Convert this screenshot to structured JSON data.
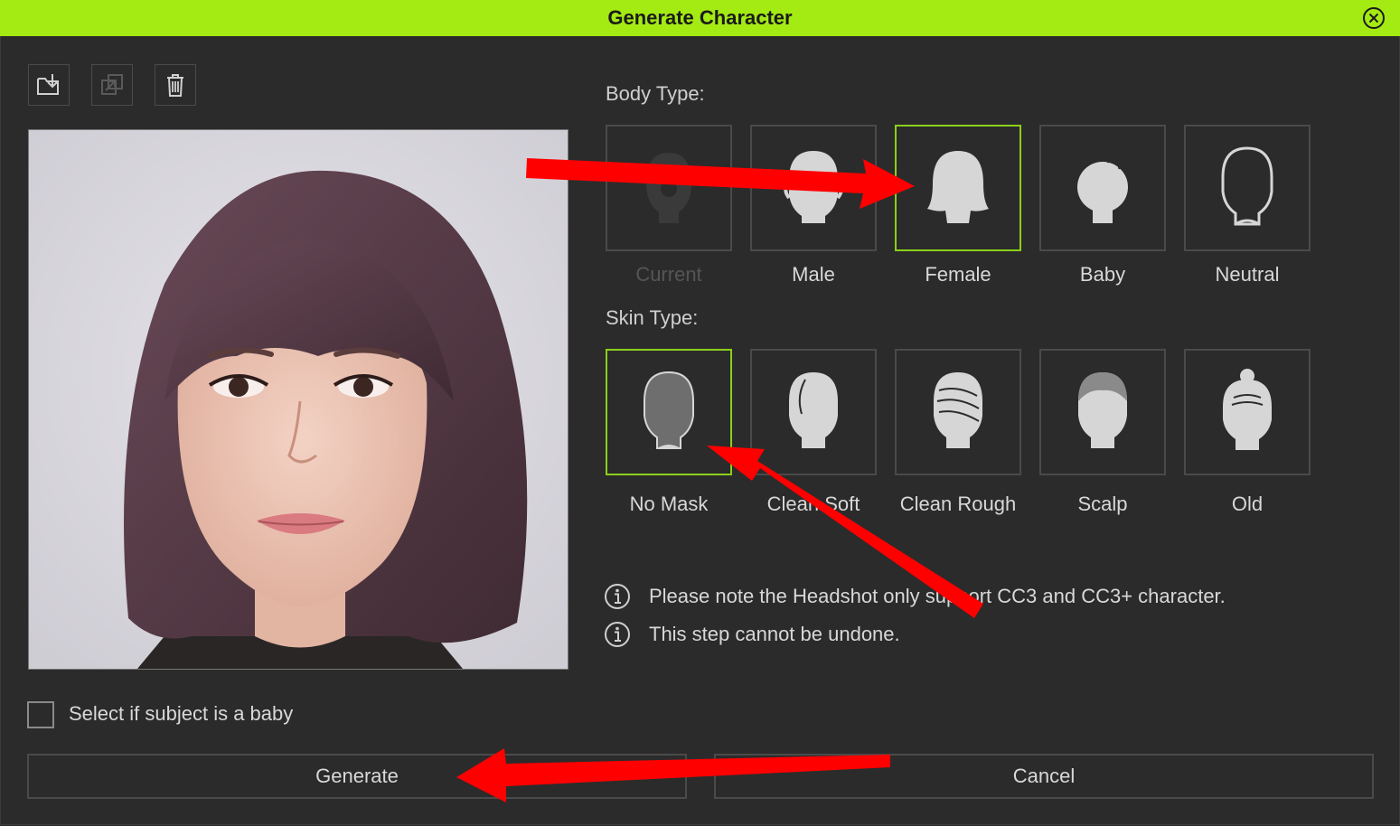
{
  "window": {
    "title": "Generate Character"
  },
  "toolbar": {
    "import_icon": "folder-import-icon",
    "replace_icon": "replace-image-icon",
    "delete_icon": "trash-icon"
  },
  "body_type": {
    "label": "Body Type:",
    "options": [
      {
        "label": "Current",
        "icon": "current-head-icon",
        "state": "disabled"
      },
      {
        "label": "Male",
        "icon": "male-head-icon",
        "state": "normal"
      },
      {
        "label": "Female",
        "icon": "female-head-icon",
        "state": "selected"
      },
      {
        "label": "Baby",
        "icon": "baby-head-icon",
        "state": "normal"
      },
      {
        "label": "Neutral",
        "icon": "neutral-head-icon",
        "state": "normal"
      }
    ]
  },
  "skin_type": {
    "label": "Skin Type:",
    "options": [
      {
        "label": "No Mask",
        "icon": "no-mask-head-icon",
        "state": "selected"
      },
      {
        "label": "Clean Soft",
        "icon": "clean-soft-head-icon",
        "state": "normal"
      },
      {
        "label": "Clean Rough",
        "icon": "clean-rough-head-icon",
        "state": "normal"
      },
      {
        "label": "Scalp",
        "icon": "scalp-head-icon",
        "state": "normal"
      },
      {
        "label": "Old",
        "icon": "old-head-icon",
        "state": "normal"
      }
    ]
  },
  "notes": [
    "Please note the Headshot only support CC3 and CC3+ character.",
    "This step cannot be undone."
  ],
  "baby_checkbox": {
    "label": "Select if subject is a baby",
    "checked": false
  },
  "buttons": {
    "generate": "Generate",
    "cancel": "Cancel"
  },
  "colors": {
    "accent": "#a4ea13",
    "selected_border": "#8ccf1a",
    "background": "#2b2b2b",
    "annotation_arrow": "#ff0000"
  }
}
